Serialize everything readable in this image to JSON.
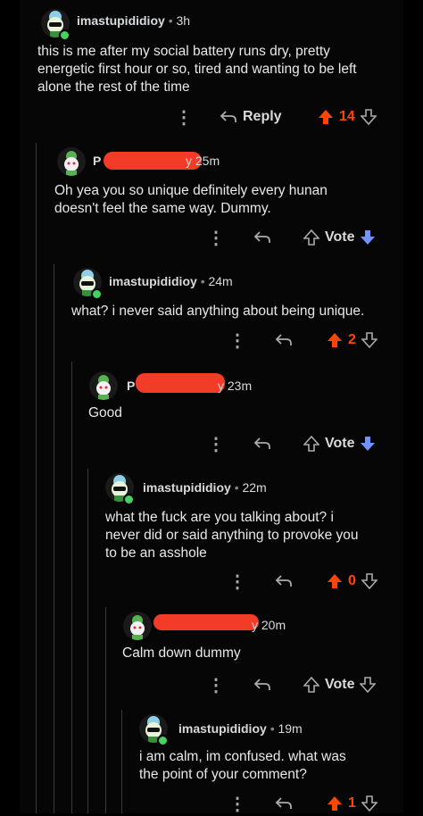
{
  "comments": [
    {
      "username": "imastupididioy",
      "age": "3h",
      "text_lines": [
        "this is me after my social battery runs dry, pretty",
        "energetic first hour or so, tired and wanting to be left",
        "alone the rest of the time"
      ],
      "reply_label": "Reply",
      "score": "14",
      "upvoted": true
    },
    {
      "username": "P",
      "username_tail": "y",
      "age": "25m",
      "text_lines": [
        "Oh yea you so unique definitely every hunan",
        "doesn't feel the same way. Dummy."
      ],
      "vote_label": "Vote",
      "downvoted": true
    },
    {
      "username": "imastupididioy",
      "age": "24m",
      "text_lines": [
        "what? i never said anything about being unique."
      ],
      "score": "2",
      "upvoted": true
    },
    {
      "username": "P",
      "username_tail": "y",
      "age": "23m",
      "text_lines": [
        "Good"
      ],
      "vote_label": "Vote",
      "downvoted": true
    },
    {
      "username": "imastupididioy",
      "age": "22m",
      "text_lines": [
        "what the fuck are you talking about? i",
        "never did or said anything to provoke you",
        "to be an asshole"
      ],
      "score": "0",
      "upvoted": true
    },
    {
      "username_tail": "y",
      "age": "20m",
      "text_lines": [
        "Calm down dummy"
      ],
      "vote_label": "Vote"
    },
    {
      "username": "imastupididioy",
      "age": "19m",
      "text_lines": [
        "i am calm, im confused. what was",
        "the point of your comment?"
      ],
      "score": "1",
      "upvoted": true
    }
  ],
  "colors": {
    "upvote": "#ff4500",
    "downvote": "#7193ff",
    "redaction": "#f23c28",
    "online": "#46d160"
  },
  "icons": [
    "overflow-menu-icon",
    "reply-arrow-icon",
    "upvote-arrow-icon",
    "downvote-arrow-icon"
  ]
}
